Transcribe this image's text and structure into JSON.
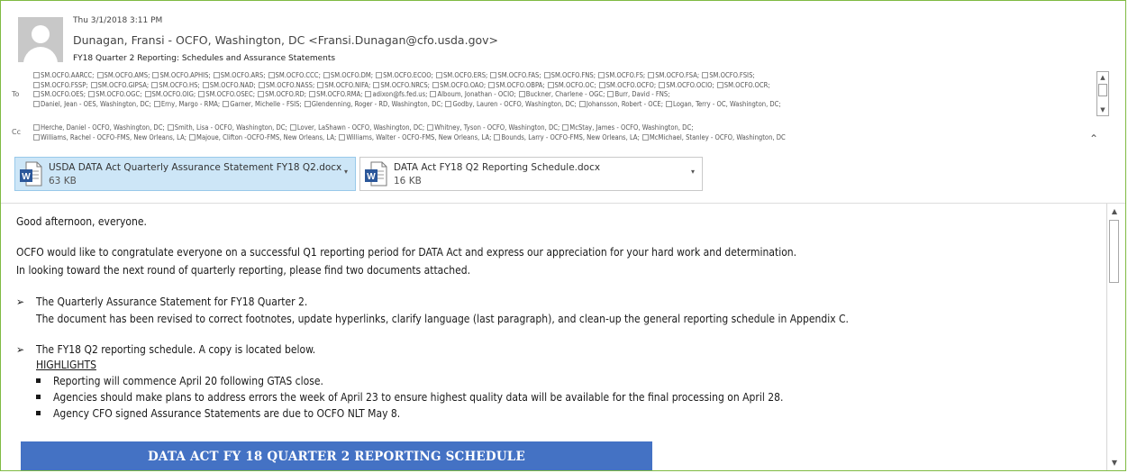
{
  "header": {
    "date": "Thu 3/1/2018 3:11 PM",
    "from": "Dunagan, Fransi - OCFO, Washington, DC <Fransi.Dunagan@cfo.usda.gov>",
    "subject": "FY18 Quarter 2 Reporting: Schedules and Assurance Statements"
  },
  "to": {
    "label": "To",
    "lines": [
      [
        "SM.OCFO.AARCC;",
        "SM.OCFO.AMS;",
        "SM.OCFO.APHIS;",
        "SM.OCFO.ARS;",
        "SM.OCFO.CCC;",
        "SM.OCFO.DM;",
        "SM.OCFO.ECOO;",
        "SM.OCFO.ERS;",
        "SM.OCFO.FAS;",
        "SM.OCFO.FNS;",
        "SM.OCFO.FS;",
        "SM.OCFO.FSA;",
        "SM.OCFO.FSIS;"
      ],
      [
        "SM.OCFO.FSSP;",
        "SM.OCFO.GIPSA;",
        "SM.OCFO.HS;",
        "SM.OCFO.NAD;",
        "SM.OCFO.NASS;",
        "SM.OCFO.NIFA;",
        "SM.OCFO.NRCS;",
        "SM.OCFO.OAO;",
        "SM.OCFO.OBPA;",
        "SM.OCFO.OC;",
        "SM.OCFO.OCFO;",
        "SM.OCFO.OCIO;",
        "SM.OCFO.OCR;"
      ],
      [
        "SM.OCFO.OES;",
        "SM.OCFO.OGC;",
        "SM.OCFO.OIG;",
        "SM.OCFO.OSEC;",
        "SM.OCFO.RD;",
        "SM.OCFO.RMA;",
        "adixon@fs.fed.us;",
        "Alboum, Jonathan - OCIO;",
        "Buckner, Charlene - OGC;",
        "Burr, David - FNS;"
      ],
      [
        "Daniel, Jean - OES, Washington, DC;",
        "Erny, Margo - RMA;",
        "Garner, Michelle - FSIS;",
        "Glendenning, Roger - RD, Washington, DC;",
        "Godby, Lauren - OCFO, Washington, DC;",
        "Johansson, Robert - OCE;",
        "Logan, Terry - OC, Washington, DC;"
      ]
    ]
  },
  "cc": {
    "label": "Cc",
    "lines": [
      [
        "Herche, Daniel - OCFO, Washington, DC;",
        "Smith, Lisa - OCFO, Washington, DC;",
        "Lover, LaShawn - OCFO, Washington, DC;",
        "Whitney, Tyson - OCFO, Washington, DC;",
        "McStay, James - OCFO, Washington, DC;"
      ],
      [
        "Williams, Rachel - OCFO-FMS, New Orleans, LA;",
        "Majoue, Clifton -OCFO-FMS, New Orleans, LA;",
        "Williams, Walter - OCFO-FMS, New Orleans, LA;",
        "Bounds, Larry - OCFO-FMS, New Orleans, LA;",
        "McMichael, Stanley - OCFO, Washington, DC"
      ]
    ]
  },
  "attachments": [
    {
      "name": "USDA DATA Act Quarterly Assurance Statement FY18 Q2.docx",
      "size": "63 KB"
    },
    {
      "name": "DATA Act FY18 Q2 Reporting Schedule.docx",
      "size": "16 KB"
    }
  ],
  "body": {
    "greeting": "Good afternoon, everyone.",
    "para1": "OCFO would like to congratulate everyone on a successful Q1 reporting period for DATA Act and express our appreciation for your hard work and determination.",
    "para2": "In looking toward the next round of quarterly reporting, please find two documents attached.",
    "item1_title": "The Quarterly Assurance Statement for FY18 Quarter 2.",
    "item1_text": "The document has been revised to correct footnotes, update hyperlinks, clarify language (last paragraph), and clean-up the general reporting schedule in Appendix C.",
    "item2_title": "The FY18 Q2 reporting schedule.  A copy is located below.",
    "highlights_label": "HIGHLIGHTS",
    "bullets": [
      "Reporting will commence April 20 following GTAS close.",
      "Agencies should make plans to address errors the week of April 23 to ensure highest quality data will be available for the final processing on April 28.",
      "Agency CFO signed Assurance Statements are due to OCFO NLT May 8."
    ],
    "banner": "DATA ACT FY 18 QUARTER 2 REPORTING SCHEDULE"
  },
  "icons": {
    "arrow": "➢",
    "collapse": "⌃",
    "dropdown": "▾",
    "scroll_up": "▲",
    "scroll_down": "▼"
  },
  "colors": {
    "frame_border": "#7fba42",
    "attachment_selected_bg": "#cde6f7",
    "banner_bg": "#4472c4",
    "word_icon_blue": "#2b579a"
  }
}
